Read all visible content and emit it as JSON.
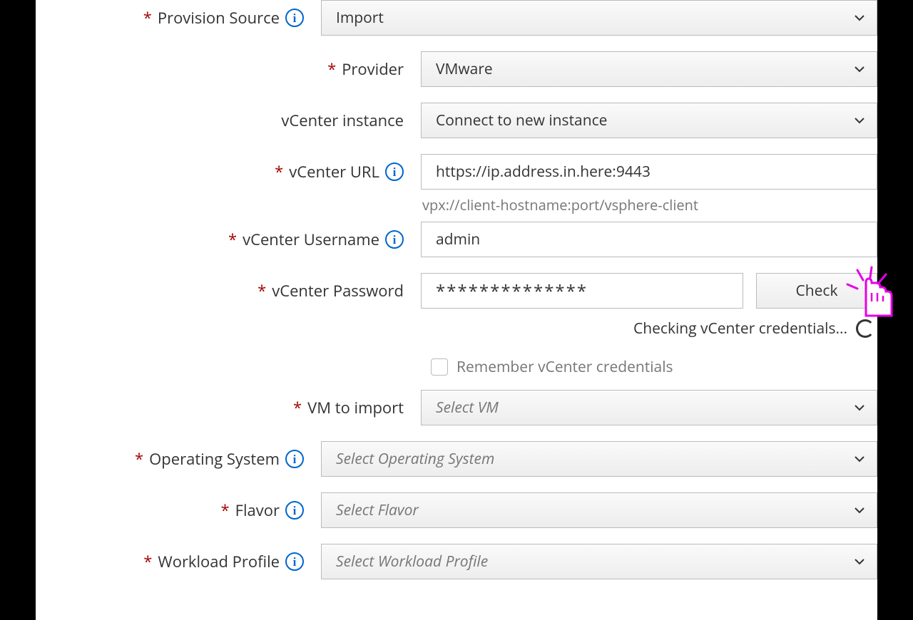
{
  "labels": {
    "provision_source": "Provision Source",
    "provider": "Provider",
    "vcenter_instance": "vCenter instance",
    "vcenter_url": "vCenter URL",
    "vcenter_username": "vCenter Username",
    "vcenter_password": "vCenter Password",
    "vm_to_import": "VM to import",
    "operating_system": "Operating System",
    "flavor": "Flavor",
    "workload_profile": "Workload Profile"
  },
  "values": {
    "provision_source": "Import",
    "provider": "VMware",
    "vcenter_instance": "Connect to new instance",
    "vcenter_url": "https://ip.address.in.here:9443",
    "vcenter_url_helper": "vpx://client-hostname:port/vsphere-client",
    "vcenter_username": "admin",
    "vcenter_password": "**************"
  },
  "placeholders": {
    "vm_to_import": "Select VM",
    "operating_system": "Select Operating System",
    "flavor": "Select Flavor",
    "workload_profile": "Select Workload Profile"
  },
  "buttons": {
    "check": "Check"
  },
  "status": {
    "checking": "Checking vCenter credentials..."
  },
  "checkbox": {
    "remember": "Remember vCenter credentials"
  },
  "required_marker": "*",
  "info_glyph": "i"
}
